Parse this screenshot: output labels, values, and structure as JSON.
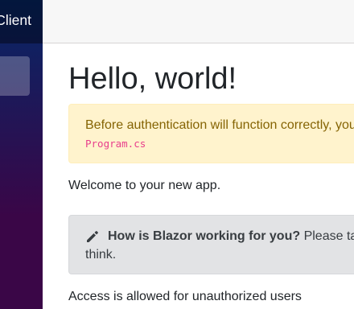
{
  "sidebar": {
    "brand": "Client",
    "active_item_label": ""
  },
  "main": {
    "heading": "Hello, world!",
    "alert": {
      "message": "Before authentication will function correctly, you",
      "code": "Program.cs"
    },
    "welcome": "Welcome to your new app.",
    "survey": {
      "icon": "pencil-icon",
      "question": "How is Blazor working for you?",
      "prompt": " Please ta",
      "continuation": "think."
    },
    "access_note": "Access is allowed for unauthorized users"
  },
  "colors": {
    "sidebar_top": "#052767",
    "sidebar_bottom": "#3a0647",
    "alert_bg": "#fff3cd",
    "alert_text": "#856404",
    "code_pink": "#e83e8c",
    "survey_bg": "#e2e3e5"
  }
}
